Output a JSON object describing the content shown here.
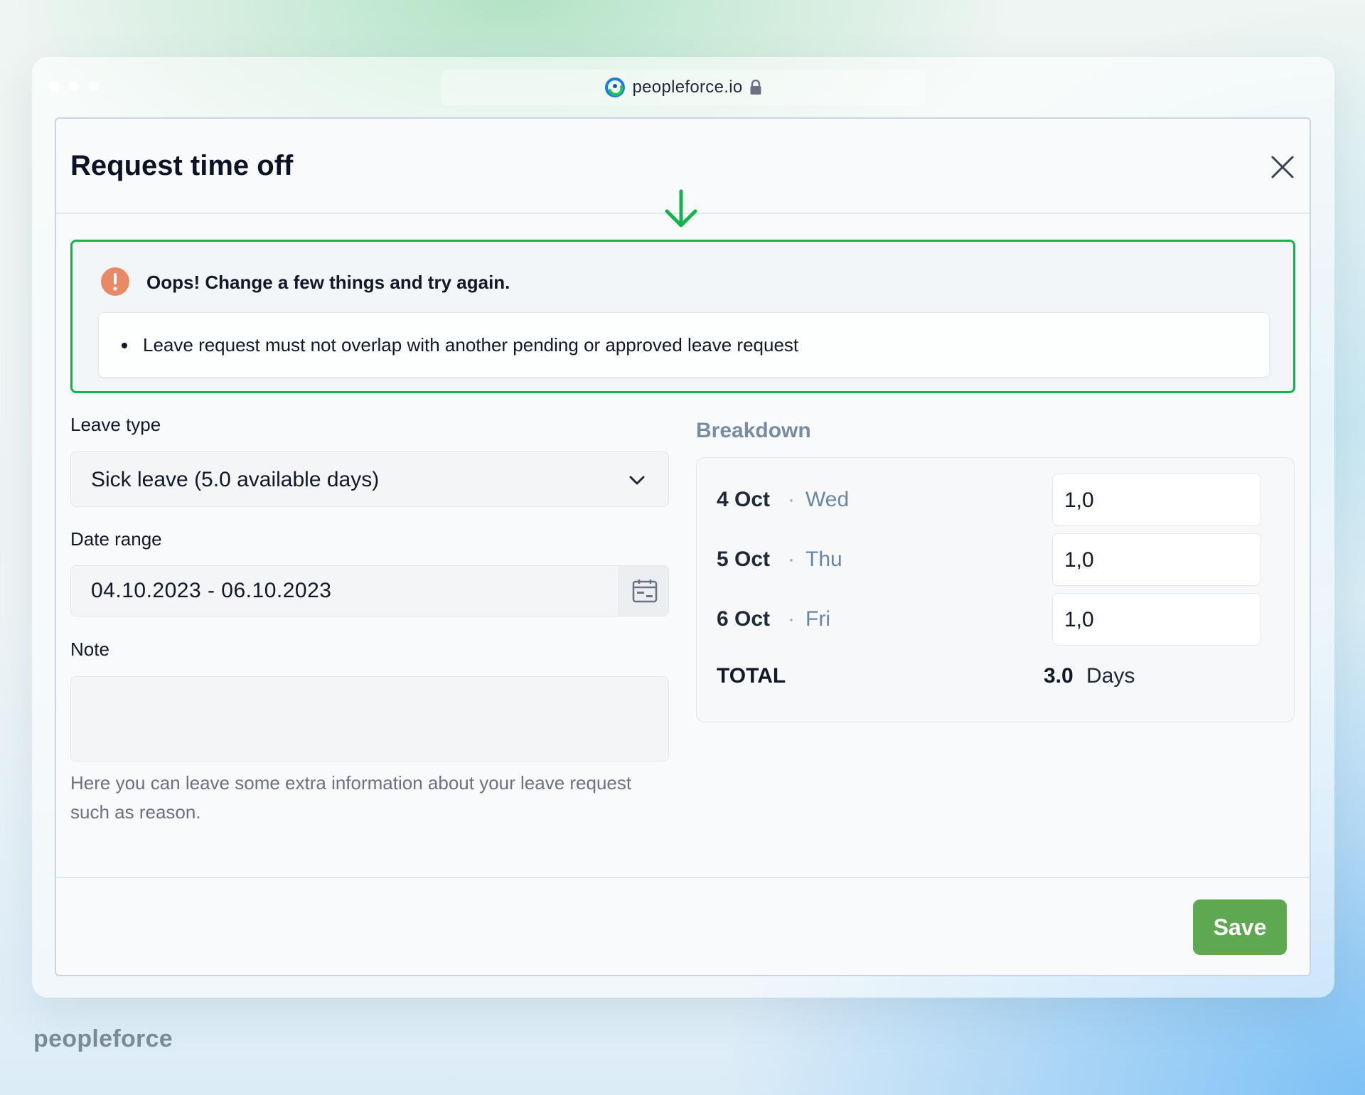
{
  "browser": {
    "url": "peopleforce.io",
    "icons": {
      "logo": "peopleforce-logo-icon",
      "lock": "lock-icon"
    }
  },
  "modal": {
    "title": "Request time off",
    "close_icon": "close-icon",
    "arrow_icon": "arrow-down-icon"
  },
  "error": {
    "title": "Oops! Change a few things and try again.",
    "items": [
      "Leave request must not overlap with another pending or approved leave request"
    ],
    "icon": "exclamation-icon",
    "border_color": "#16b24b",
    "icon_color": "#e88a68"
  },
  "form": {
    "leave_type": {
      "label": "Leave type",
      "value": "Sick leave (5.0 available days)"
    },
    "date_range": {
      "label": "Date range",
      "value": "04.10.2023 - 06.10.2023"
    },
    "note": {
      "label": "Note",
      "value": "",
      "hint": "Here you can leave some extra information about your leave request such as reason."
    }
  },
  "breakdown": {
    "title": "Breakdown",
    "rows": [
      {
        "date": "4 Oct",
        "day": "Wed",
        "value": "1,0"
      },
      {
        "date": "5 Oct",
        "day": "Thu",
        "value": "1,0"
      },
      {
        "date": "6 Oct",
        "day": "Fri",
        "value": "1,0"
      }
    ],
    "separator": "·",
    "total_label": "TOTAL",
    "total_value": "3.0",
    "total_unit": "Days"
  },
  "footer": {
    "save_label": "Save",
    "save_color": "#5ea84f"
  },
  "brand": {
    "name": "peopleforce"
  }
}
